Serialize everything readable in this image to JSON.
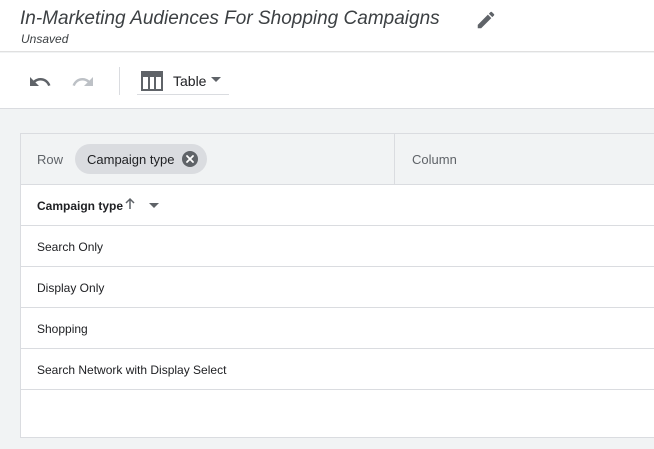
{
  "header": {
    "title": "In-Marketing Audiences For Shopping Campaigns",
    "status": "Unsaved",
    "edit_icon": "pencil-icon"
  },
  "toolbar": {
    "undo_icon": "undo-icon",
    "redo_icon": "redo-icon",
    "view_icon": "table-icon",
    "view_label": "Table"
  },
  "pivot": {
    "row_label": "Row",
    "row_chip": "Campaign type",
    "column_label": "Column"
  },
  "table": {
    "column_header": "Campaign type",
    "sort": "ascending",
    "rows": [
      "Search Only",
      "Display Only",
      "Shopping",
      "Search Network with Display Select"
    ]
  },
  "colors": {
    "background": "#f1f3f4",
    "chip": "#dadce0",
    "icon": "#5f6368",
    "icon_disabled": "#bdc1c6"
  }
}
